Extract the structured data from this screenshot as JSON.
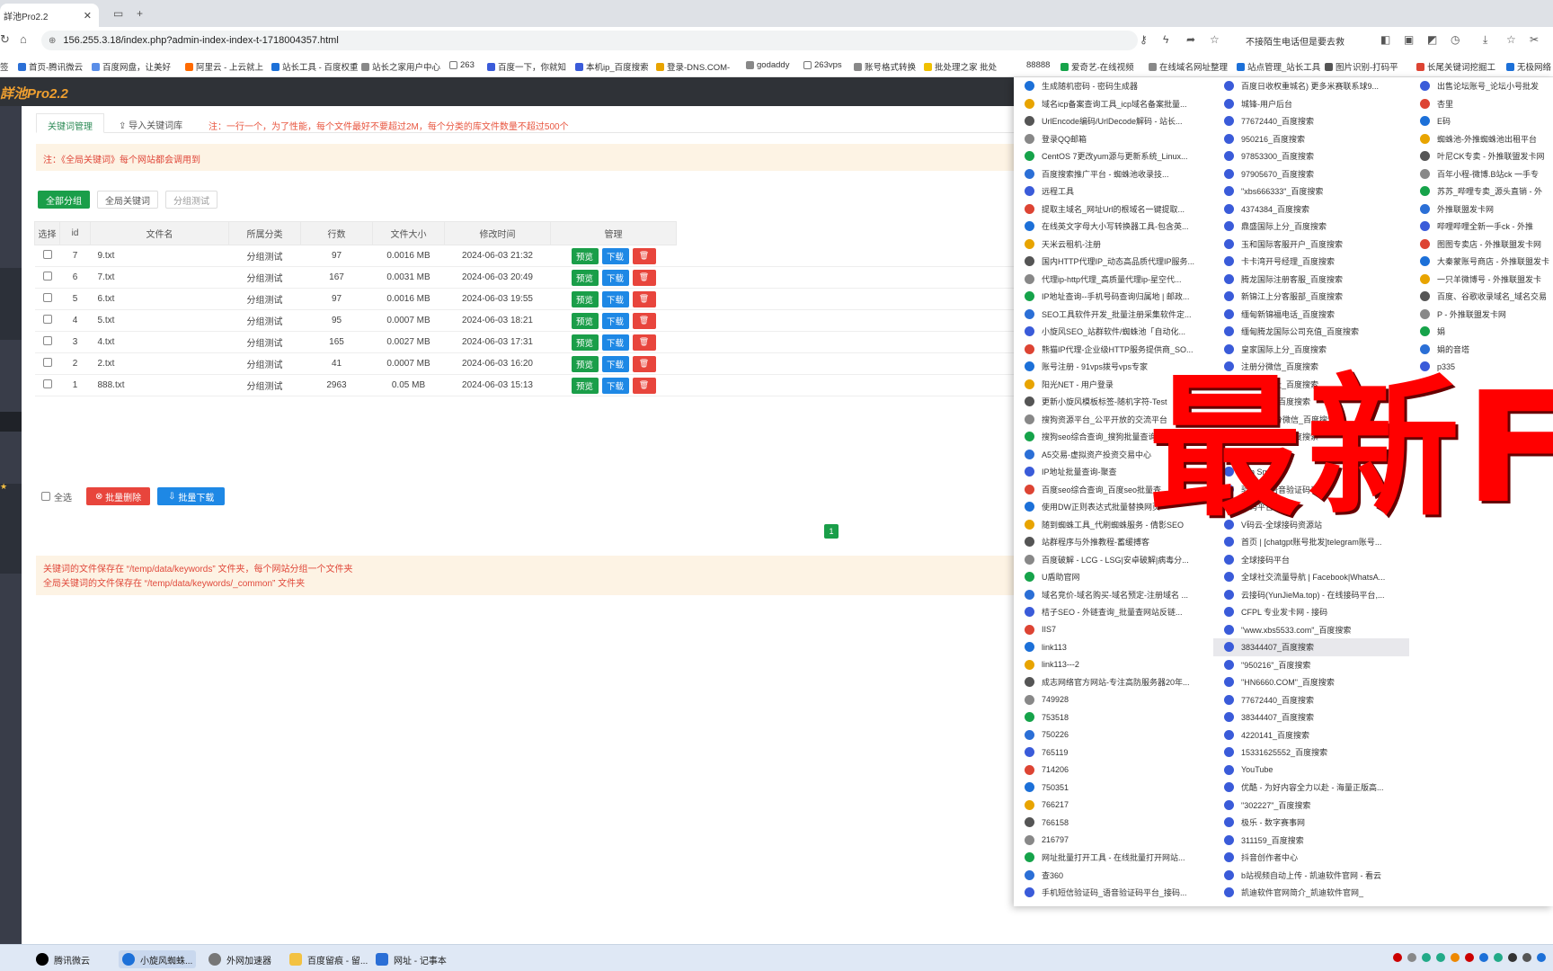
{
  "browser": {
    "tab_title": "詳池Pro2.2",
    "url": "156.255.3.18/index.php?admin-index-index-t-1718004357.html",
    "extension_text": "不接陌生电话但是要去救",
    "bookmarks": [
      "签",
      "首页-腾讯微云",
      "百度网盘，让美好",
      "阿里云 - 上云就上",
      "站长工具 - 百度权重",
      "站长之家用户中心",
      "263",
      "百度一下，你就知",
      "本机ip_百度搜索",
      "登录-DNS.COM-",
      "godaddy",
      "263vps",
      "账号格式转换",
      "批处理之家 批处",
      "88888",
      "爱奇艺-在线视频",
      "在线域名网址整理",
      "站点管理_站长工具",
      "图片识别-打码平",
      "长尾关键词挖掘工",
      "无极网络"
    ]
  },
  "app": {
    "brand": "詳池Pro2.2",
    "tabs": {
      "keywords": "关键词管理",
      "import": "导入关键词库",
      "import_note": "注：一行一个，为了性能，每个文件最好不要超过2M，每个分类的库文件数量不超过500个"
    },
    "notice": "注：《全局关键词》每个网站都会调用到",
    "group_buttons": [
      "全部分组",
      "全局关键词",
      "分组测试"
    ],
    "table": {
      "headers": [
        "选择",
        "id",
        "文件名",
        "所属分类",
        "行数",
        "文件大小",
        "修改时间",
        "管理"
      ],
      "rows": [
        {
          "id": "7",
          "name": "9.txt",
          "cat": "分组测试",
          "lines": "97",
          "size": "0.0016 MB",
          "time": "2024-06-03 21:32"
        },
        {
          "id": "6",
          "name": "7.txt",
          "cat": "分组测试",
          "lines": "167",
          "size": "0.0031 MB",
          "time": "2024-06-03 20:49"
        },
        {
          "id": "5",
          "name": "6.txt",
          "cat": "分组测试",
          "lines": "97",
          "size": "0.0016 MB",
          "time": "2024-06-03 19:55"
        },
        {
          "id": "4",
          "name": "5.txt",
          "cat": "分组测试",
          "lines": "95",
          "size": "0.0007 MB",
          "time": "2024-06-03 18:21"
        },
        {
          "id": "3",
          "name": "4.txt",
          "cat": "分组测试",
          "lines": "165",
          "size": "0.0027 MB",
          "time": "2024-06-03 17:31"
        },
        {
          "id": "2",
          "name": "2.txt",
          "cat": "分组测试",
          "lines": "41",
          "size": "0.0007 MB",
          "time": "2024-06-03 16:20"
        },
        {
          "id": "1",
          "name": "888.txt",
          "cat": "分组测试",
          "lines": "2963",
          "size": "0.05 MB",
          "time": "2024-06-03 15:13"
        }
      ],
      "actions": {
        "preview": "预览",
        "download": "下载",
        "delete": "🗑"
      }
    },
    "bulk": {
      "select_all": "全选",
      "delete": "批量删除",
      "download": "批量下载"
    },
    "page": "1",
    "info": [
      "关键词的文件保存在 “/temp/data/keywords” 文件夹，每个网站分组一个文件夹",
      "全局关键词的文件保存在 “/temp/data/keywords/_common” 文件夹"
    ]
  },
  "dropdown": {
    "col1": [
      "生成随机密码 - 密码生成器",
      "域名icp备案查询工具_icp域名备案批量...",
      "UrlEncode编码/UrlDecode解码 - 站长...",
      "登录QQ邮箱",
      "CentOS 7更改yum源与更新系统_Linux...",
      "百度搜索推广平台 - 蜘蛛池收录技...",
      "远程工具",
      "提取主域名_网址Url的根域名一键提取...",
      "在线英文字母大小写转换器工具-包含英...",
      "天米云租机-注册",
      "国内HTTP代理IP_动态高品质代理IP服务...",
      "代理ip-http代理_高质量代理ip-星空代...",
      "IP地址查询--手机号码查询归属地 | 邮政...",
      "SEO工具软件开发_批量注册采集软件定...",
      "小旋风SEO_站群软件/蜘蛛池「自动化...",
      "熊猫IP代理-企业级HTTP服务提供商_SO...",
      "账号注册 - 91vps拨号vps专家",
      "阳光NET - 用户登录",
      "更新小旋风模板标签-随机字符-Test",
      "搜狗资源平台_公平开放的交流平台",
      "搜狗seo综合查询_搜狗批量查询",
      "A5交易-虚拟资产投资交易中心",
      "IP地址批量查询-聚查",
      "百度seo综合查询_百度seo批量查",
      "使用DW正则表达式批量替换网页",
      "随到蜘蛛工具_代刷蜘蛛服务 - 倩影SEO",
      "站群程序与外推教程-蓄缓搏客",
      "百度破解 - LCG - LSG|安卓破解|病毒分...",
      "U盾助官网",
      "域名竞价-域名购买-域名预定-注册域名 ...",
      "桔子SEO - 外链查询_批量查网站反链...",
      "IIS7",
      "link113",
      "link113---2",
      "成志网络官方网站-专注高防服务器20年...",
      "749928",
      "753518",
      "750226",
      "765119",
      "714206",
      "750351",
      "766217",
      "766158",
      "216797",
      "网址批量打开工具 - 在线批量打开网站...",
      "查360",
      "手机短信验证码_语音验证码平台_接码..."
    ],
    "col2": [
      "百度日收权重城名) 更多米赛联系球9...",
      "城锋-用户后台",
      "77672440_百度搜索",
      "950216_百度搜索",
      "97853300_百度搜索",
      "97905670_百度搜索",
      "\"xbs666333\"_百度搜索",
      "4374384_百度搜索",
      "鼎盛国际上分_百度搜索",
      "玉和国际客服开户_百度搜索",
      "卡卡湾开号经理_百度搜索",
      "腾龙国际注册客服_百度搜索",
      "新锦江上分客服部_百度搜索",
      "缅甸新锦福电话_百度搜索",
      "缅甸腾龙国际公司充值_百度搜索",
      "皇家国际上分_百度搜索",
      "注册分微信_百度搜索",
      "索注册网址_百度搜索",
      "财务微信_百度搜索",
      "99开上下分微信_百度搜索",
      "搜索关键词_百度搜索",
      "平台 | 免费的",
      "ban Sms",
      "验证码_语音验证码平台",
      "号码平台",
      "V码云-全球接码资源站",
      "首页 | [chatgpt账号批发]telegram账号...",
      "全球接码平台",
      "全球社交流量导航 | Facebook|WhatsA...",
      "云接码(YunJieMa.top) - 在线接码平台,...",
      "CFPL 专业发卡网 - 接码",
      "\"www.xbs5533.com\"_百度搜索",
      "38344407_百度搜索",
      "\"950216\"_百度搜索",
      "\"HN6660.COM\"_百度搜索",
      "77672440_百度搜索",
      "38344407_百度搜索",
      "4220141_百度搜索",
      "15331625552_百度搜索",
      "YouTube",
      "优酷 - 为好内容全力以赴 - 海量正版高...",
      "\"302227\"_百度搜索",
      "极乐 - 数字赛事网",
      "311159_百度搜索",
      "抖音创作者中心",
      "b站视频自动上传 - 凯迪软件官网 - 看云",
      "凯迪软件官网简介_凯迪软件官网_"
    ],
    "col3": [
      "出售论坛账号_论坛小号批发",
      "杏里",
      "E码",
      "蜘蛛池-外推蜘蛛池出租平台",
      "叶尼CK专卖 - 外推联盟发卡网",
      "百年小程-微博.B站ck 一手专",
      "苏苏_哔哩专卖_源头直销 - 外",
      "外推联盟发卡网",
      "哔哩哔哩全新一手ck - 外推",
      "图图专卖店 - 外推联盟发卡网",
      "大秦蒙账号商店 - 外推联盟发卡",
      "一只羊微博号 - 外推联盟发卡",
      "百度、谷歌收录域名_域名交易",
      "P - 外推联盟发卡网",
      "娟",
      "娟的音塔",
      "p335"
    ]
  },
  "overlay": "最新F",
  "taskbar": [
    "腾讯微云",
    "小旋风蜘蛛...",
    "外网加速器",
    "百度留痕 - 留...",
    "网址 - 记事本"
  ]
}
